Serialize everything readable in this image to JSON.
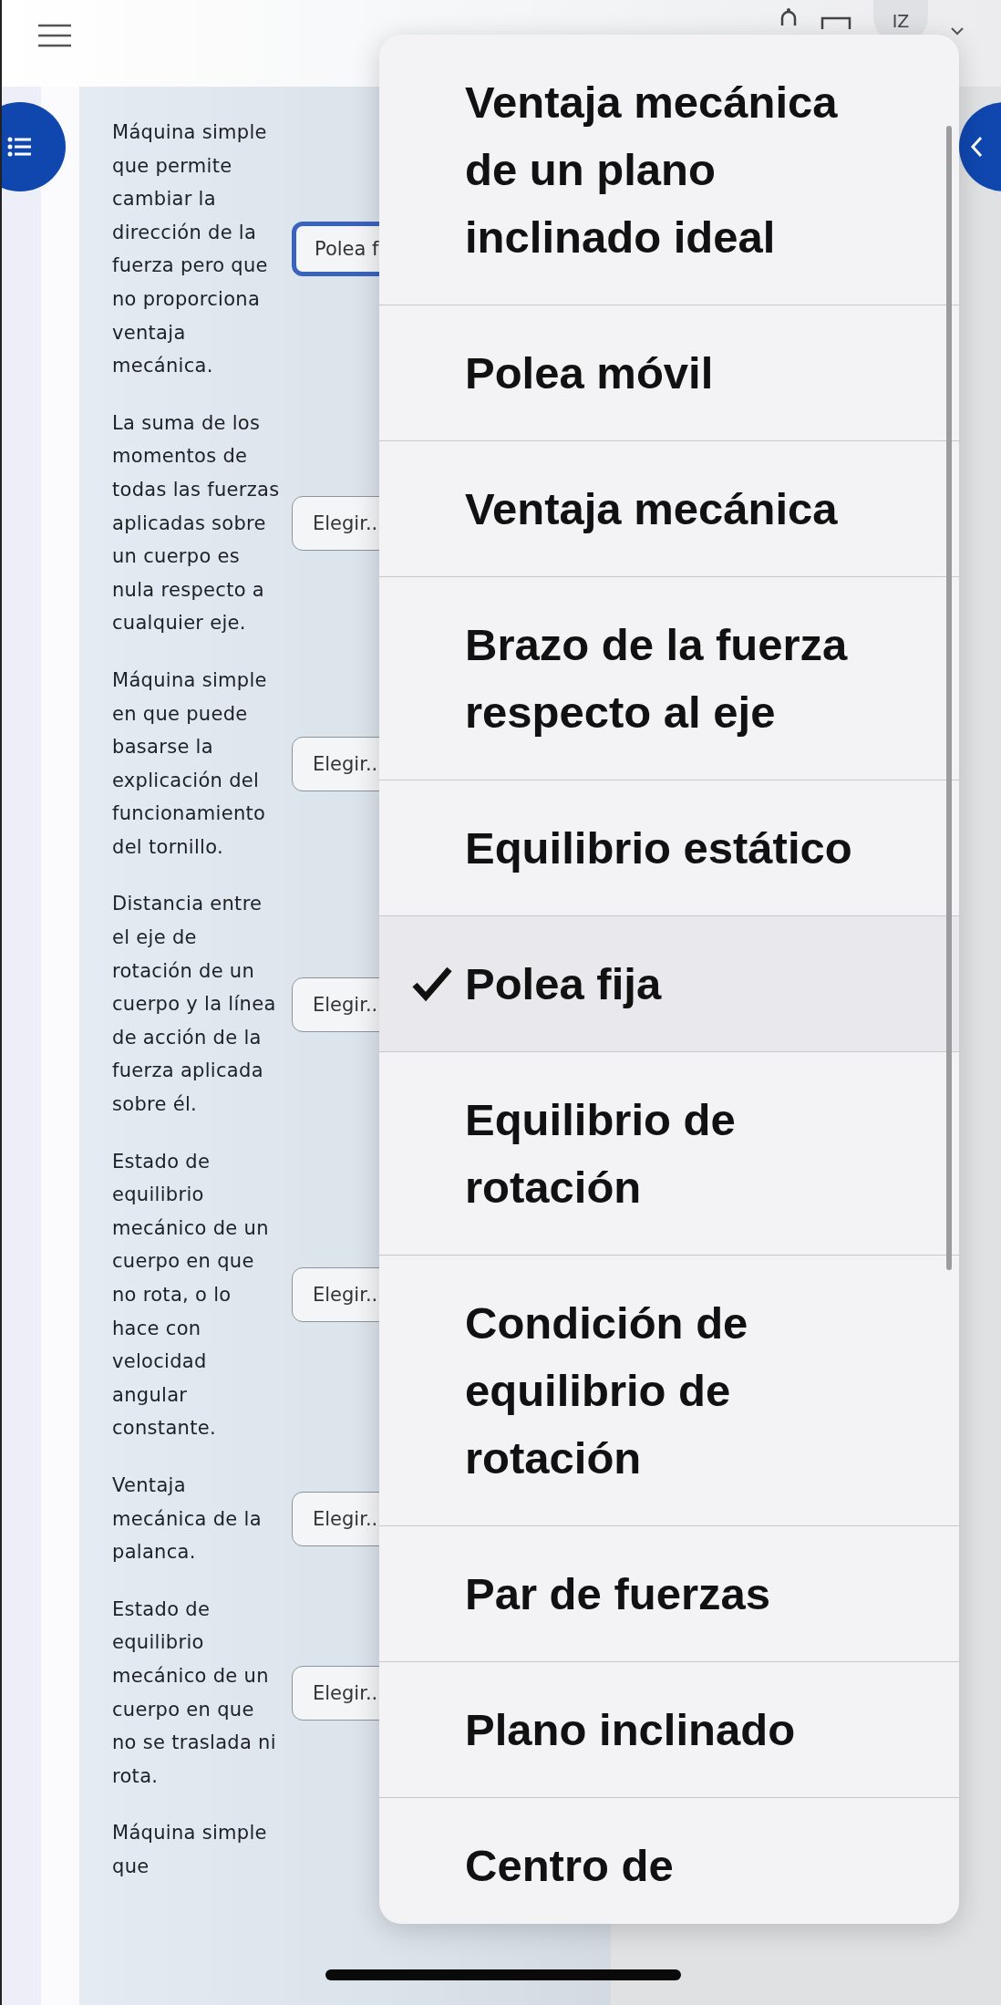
{
  "header": {
    "avatar": "IZ"
  },
  "questions": [
    {
      "text": "Máquina simple que permite cambiar la dirección de la fuerza pero que no proporciona ventaja mecánica.",
      "select": {
        "value": "Polea f",
        "focused": true
      }
    },
    {
      "text": "La suma de los momentos de todas las fuerzas aplicadas sobre un cuerpo es nula respecto a cualquier eje.",
      "select": {
        "value": "Elegir..",
        "focused": false
      }
    },
    {
      "text": "Máquina simple en que puede basarse la explicación del funcionamiento del tornillo.",
      "select": {
        "value": "Elegir..",
        "focused": false
      }
    },
    {
      "text": "Distancia entre el eje de rotación de un cuerpo y la línea de acción de la fuerza aplicada sobre él.",
      "select": {
        "value": "Elegir..",
        "focused": false
      }
    },
    {
      "text": "Estado de equilibrio mecánico de un cuerpo en que no rota, o lo hace con velocidad angular constante.",
      "select": {
        "value": "Elegir..",
        "focused": false
      }
    },
    {
      "text": "Ventaja mecánica de la palanca.",
      "select": {
        "value": "Elegir..",
        "focused": false
      }
    },
    {
      "text": "Estado de equilibrio mecánico de un cuerpo en que no se traslada ni rota.",
      "select": {
        "value": "Elegir..",
        "focused": false
      }
    },
    {
      "text": "Máquina simple que"
    }
  ],
  "options": [
    {
      "label": "Ventaja mecánica de un plano inclinado ideal",
      "selected": false
    },
    {
      "label": "Polea móvil",
      "selected": false
    },
    {
      "label": "Ventaja mecánica",
      "selected": false
    },
    {
      "label": "Brazo de la fuerza respecto al eje",
      "selected": false
    },
    {
      "label": "Equilibrio estático",
      "selected": false
    },
    {
      "label": "Polea fija",
      "selected": true
    },
    {
      "label": "Equilibrio de rotación",
      "selected": false
    },
    {
      "label": "Condición de equilibrio de rotación",
      "selected": false
    },
    {
      "label": "Par de fuerzas",
      "selected": false
    },
    {
      "label": "Plano inclinado",
      "selected": false
    },
    {
      "label": "Centro de",
      "selected": false
    }
  ]
}
